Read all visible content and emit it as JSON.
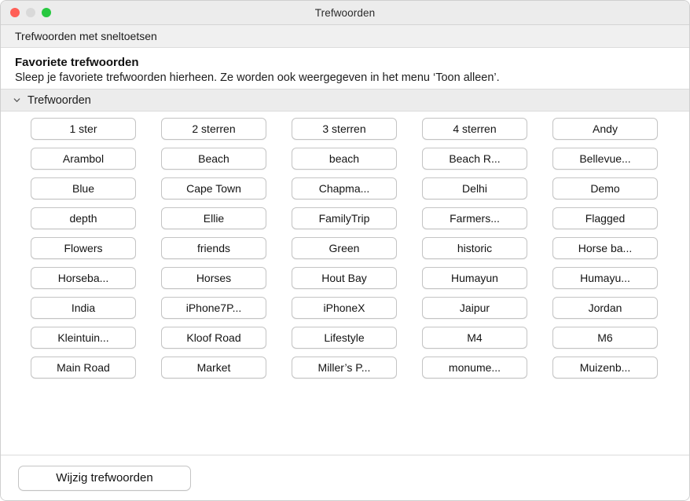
{
  "window": {
    "title": "Trefwoorden",
    "traffic_lights": [
      "close",
      "minimize",
      "maximize"
    ]
  },
  "subheader": {
    "label": "Trefwoorden met sneltoetsen"
  },
  "favorites": {
    "title": "Favoriete trefwoorden",
    "description": "Sleep je favoriete trefwoorden hierheen. Ze worden ook weergegeven in het menu ‘Toon alleen’."
  },
  "section": {
    "title": "Trefwoorden",
    "disclosure_icon": "chevron-down-icon",
    "expanded": true
  },
  "keywords": [
    "1 ster",
    "2 sterren",
    "3 sterren",
    "4 sterren",
    "Andy",
    "Arambol",
    "Beach",
    "beach",
    "Beach R...",
    "Bellevue...",
    "Blue",
    "Cape Town",
    "Chapma...",
    "Delhi",
    "Demo",
    "depth",
    "Ellie",
    "FamilyTrip",
    "Farmers...",
    "Flagged",
    "Flowers",
    "friends",
    "Green",
    "historic",
    "Horse ba...",
    "Horseba...",
    "Horses",
    "Hout Bay",
    "Humayun",
    "Humayu...",
    "India",
    "iPhone7P...",
    "iPhoneX",
    "Jaipur",
    "Jordan",
    "Kleintuin...",
    "Kloof Road",
    "Lifestyle",
    "M4",
    "M6",
    "Main Road",
    "Market",
    "Miller’s P...",
    "monume...",
    "Muizenb..."
  ],
  "footer": {
    "edit_button": "Wijzig trefwoorden"
  }
}
